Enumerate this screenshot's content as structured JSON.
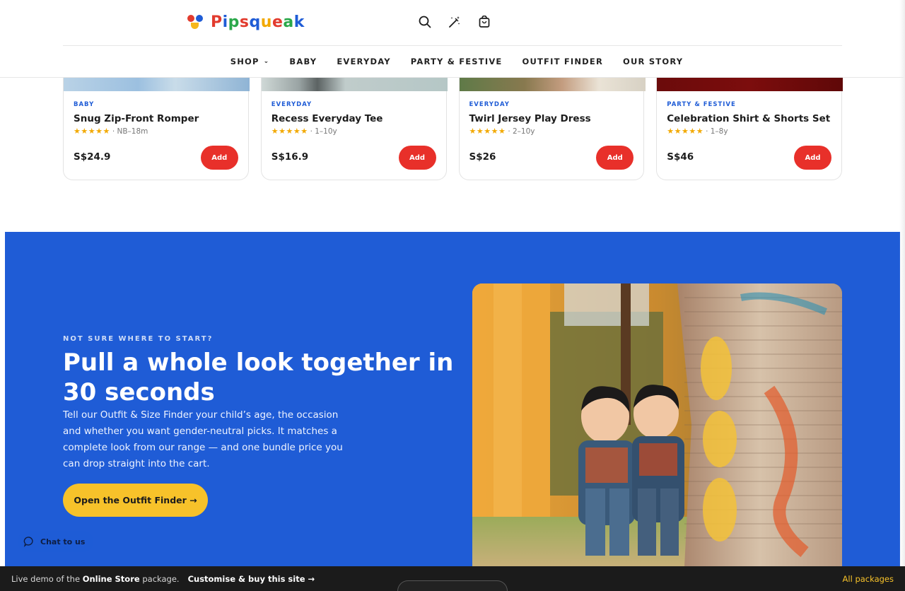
{
  "brand": {
    "name": "Pipsqueak"
  },
  "header_icons": [
    "search-icon",
    "magic-wand-icon",
    "shopping-bag-icon"
  ],
  "nav": {
    "items": [
      {
        "label": "SHOP",
        "has_dropdown": true
      },
      {
        "label": "BABY"
      },
      {
        "label": "EVERYDAY"
      },
      {
        "label": "PARTY & FESTIVE"
      },
      {
        "label": "OUTFIT FINDER"
      },
      {
        "label": "OUR STORY"
      }
    ]
  },
  "products": [
    {
      "category": "BABY",
      "title": "Snug Zip-Front Romper",
      "stars": "★★★★★",
      "size": "· NB–18m",
      "price": "S$24.9",
      "add_label": "Add"
    },
    {
      "category": "EVERYDAY",
      "title": "Recess Everyday Tee",
      "stars": "★★★★★",
      "size": "· 1–10y",
      "price": "S$16.9",
      "add_label": "Add"
    },
    {
      "category": "EVERYDAY",
      "title": "Twirl Jersey Play Dress",
      "stars": "★★★★★",
      "size": "· 2–10y",
      "price": "S$26",
      "add_label": "Add"
    },
    {
      "category": "PARTY & FESTIVE",
      "title": "Celebration Shirt & Shorts Set",
      "stars": "★★★★★",
      "size": "· 1–8y",
      "price": "S$46",
      "add_label": "Add"
    }
  ],
  "promo": {
    "eyebrow": "NOT SURE WHERE TO START?",
    "title": "Pull a whole look together in 30 seconds",
    "body": "Tell our Outfit & Size Finder your child’s age, the occasion and whether you want gender-neutral picks. It matches a complete look from our range — and one bundle price you can drop straight into the cart.",
    "button": "Open the Outfit Finder →"
  },
  "chat": {
    "label": "Chat to us"
  },
  "demo_bar": {
    "prefix": "Live demo of the",
    "package": "Online Store",
    "suffix": "package.",
    "customise": "Customise & buy this site →",
    "all_packages": "All packages"
  },
  "colors": {
    "brand_blue": "#1f5cd6",
    "add_red": "#e8302a",
    "cta_yellow": "#f7c22a",
    "star_gold": "#f2a900",
    "demo_bar_bg": "#1b1b1b"
  }
}
